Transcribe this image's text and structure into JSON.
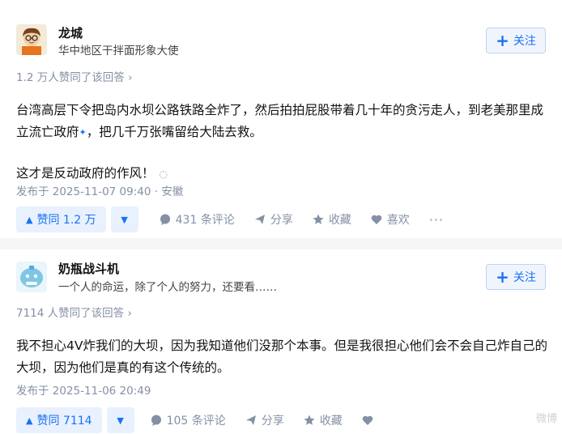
{
  "answers": [
    {
      "author_name": "龙城",
      "author_headline": "华中地区干拌面形象大使",
      "follow_label": "关注",
      "vote_summary": "1.2 万人赞同了该回答",
      "paragraphs": [
        "台湾高层下令把岛内水坝公路铁路全炸了，然后拍拍屁股带着几十年的贪污走人，到老美那里成立流亡政府",
        "，把几千万张嘴留给大陆去救。",
        "这才是反动政府的作风！"
      ],
      "meta": "发布于 2025-11-07 09:40 · 安徽",
      "upvote_label": "赞同 1.2 万",
      "comment_label": "431 条评论",
      "share_label": "分享",
      "collect_label": "收藏",
      "like_label": "喜欢"
    },
    {
      "author_name": "奶瓶战斗机",
      "author_headline": "一个人的命运，除了个人的努力，还要看……",
      "follow_label": "关注",
      "vote_summary": "7114 人赞同了该回答",
      "paragraphs": [
        "我不担心4V炸我们的大坝，因为我知道他们没那个本事。但是我很担心他们会不会自己炸自己的大坝，因为他们是真的有这个传统的。"
      ],
      "meta": "发布于 2025-11-06 20:49",
      "upvote_label": "赞同 7114",
      "comment_label": "105 条评论",
      "share_label": "分享",
      "collect_label": "收藏"
    }
  ],
  "watermark": "微博",
  "colors": {
    "accent": "#1772f6",
    "muted": "#8590a6",
    "upvote_bg": "#e8f1fd"
  }
}
